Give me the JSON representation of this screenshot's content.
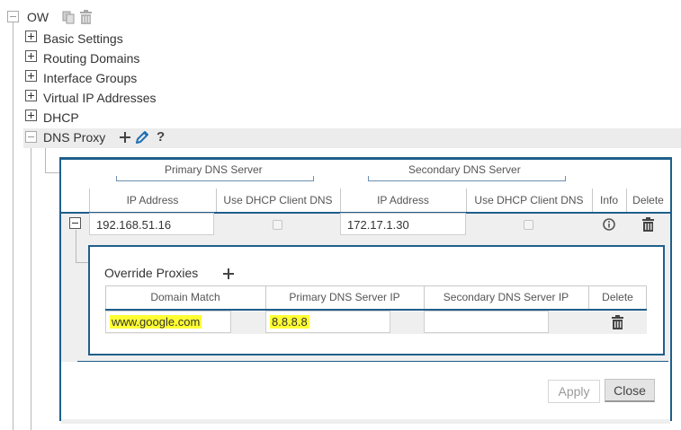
{
  "tree": {
    "root_label": "OW",
    "items": [
      {
        "label": "Basic Settings"
      },
      {
        "label": "Routing Domains"
      },
      {
        "label": "Interface Groups"
      },
      {
        "label": "Virtual IP Addresses"
      },
      {
        "label": "DHCP"
      },
      {
        "label": "DNS Proxy"
      }
    ]
  },
  "dns_actions": {
    "help_label": "?"
  },
  "dns_table": {
    "primary_group": "Primary DNS Server",
    "secondary_group": "Secondary DNS Server",
    "headers": {
      "ip_address": "IP Address",
      "use_dhcp": "Use DHCP Client DNS",
      "ip_address2": "IP Address",
      "use_dhcp2": "Use DHCP Client DNS",
      "info": "Info",
      "delete": "Delete"
    },
    "row": {
      "primary_ip": "192.168.51.16",
      "primary_use_dhcp": false,
      "secondary_ip": "172.17.1.30",
      "secondary_use_dhcp": false
    }
  },
  "override": {
    "title": "Override Proxies",
    "headers": {
      "domain": "Domain Match",
      "primary": "Primary DNS Server IP",
      "secondary": "Secondary DNS Server IP",
      "delete": "Delete"
    },
    "row": {
      "domain": "www.google.com",
      "primary": "8.8.8.8",
      "secondary": ""
    }
  },
  "buttons": {
    "apply": "Apply",
    "close": "Close"
  },
  "colors": {
    "accent": "#1f5f8b",
    "highlight": "#ffff33",
    "pencil": "#1f6fb3"
  }
}
